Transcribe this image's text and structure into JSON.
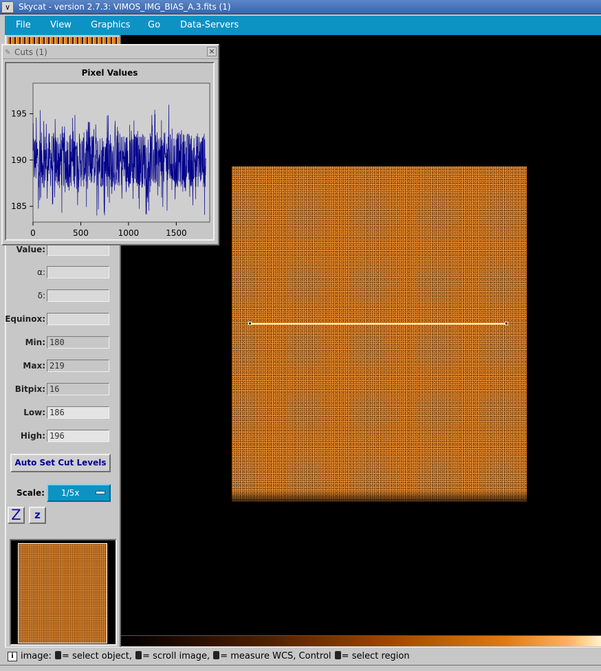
{
  "window": {
    "title": "Skycat - version 2.7.3: VIMOS_IMG_BIAS_A.3.fits (1)",
    "menu_button": "∨"
  },
  "menu": [
    "File",
    "View",
    "Graphics",
    "Go",
    "Data-Servers"
  ],
  "cuts_dialog": {
    "title": "Cuts (1)",
    "close": "×",
    "graph_title": "Pixel Values",
    "y_ticks": [
      "195",
      "190",
      "185"
    ],
    "x_ticks": [
      "0",
      "500",
      "1000",
      "1500"
    ]
  },
  "chart_data": {
    "type": "line",
    "title": "Pixel Values",
    "xlabel": "",
    "ylabel": "",
    "xlim": [
      0,
      1850
    ],
    "ylim": [
      183.3,
      198.3
    ],
    "series": [
      {
        "x_range": [
          0,
          1810
        ],
        "typical_range": [
          187,
          193
        ],
        "min": 184,
        "max": 196,
        "color": "#00008b"
      }
    ],
    "x_ticks": [
      0,
      500,
      1000,
      1500
    ],
    "y_ticks": [
      185,
      190,
      195
    ]
  },
  "info_panel": {
    "fields": [
      {
        "label": "Value:",
        "value": ""
      },
      {
        "label": "α:",
        "value": ""
      },
      {
        "label": "δ:",
        "value": ""
      },
      {
        "label": "Equinox:",
        "value": ""
      },
      {
        "label": "Min:",
        "value": "180"
      },
      {
        "label": "Max:",
        "value": "219"
      },
      {
        "label": "Bitpix:",
        "value": "16"
      },
      {
        "label": "Low:",
        "value": "186"
      },
      {
        "label": "High:",
        "value": "196"
      }
    ],
    "auto_set_button": "Auto Set Cut Levels",
    "scale_label": "Scale:",
    "scale_value": "1/5x",
    "zoom_in": "Z",
    "zoom_out": "z"
  },
  "status": {
    "icon": "i",
    "parts": [
      "image:",
      "= select object,",
      "= scroll image,",
      "= measure WCS, Control",
      "= select region"
    ]
  }
}
